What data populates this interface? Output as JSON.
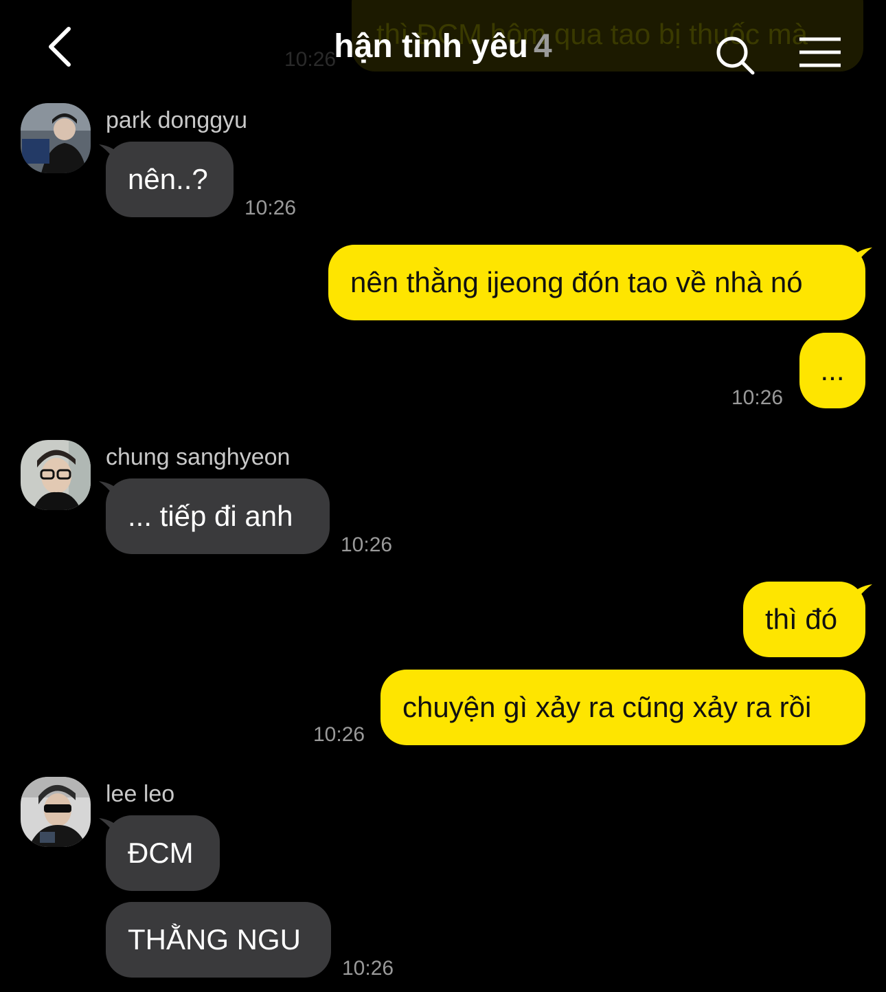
{
  "header": {
    "title": "hận tình yêu",
    "member_count": "4"
  },
  "ghost": {
    "text": "thì ĐCM hôm qua tao bị thuốc mà",
    "time": "10:26"
  },
  "messages": [
    {
      "sender": "park donggyu",
      "text": "nên..?",
      "time": "10:26"
    },
    {
      "text": "nên thằng ijeong đón tao về nhà nó"
    },
    {
      "text": "...",
      "time": "10:26"
    },
    {
      "sender": "chung sanghyeon",
      "text": "... tiếp đi anh",
      "time": "10:26"
    },
    {
      "text": "thì đó"
    },
    {
      "text": "chuyện gì xảy ra cũng xảy ra rồi",
      "time": "10:26"
    },
    {
      "sender": "lee leo",
      "text": "ĐCM"
    },
    {
      "text": "THẰNG NGU",
      "time": "10:26"
    }
  ],
  "colors": {
    "background": "#000000",
    "incoming_bubble": "#3a3a3c",
    "outgoing_bubble": "#fee500",
    "timestamp": "#9a9a9a"
  },
  "icons": [
    "chevron-left-icon",
    "search-icon",
    "hamburger-menu-icon"
  ]
}
